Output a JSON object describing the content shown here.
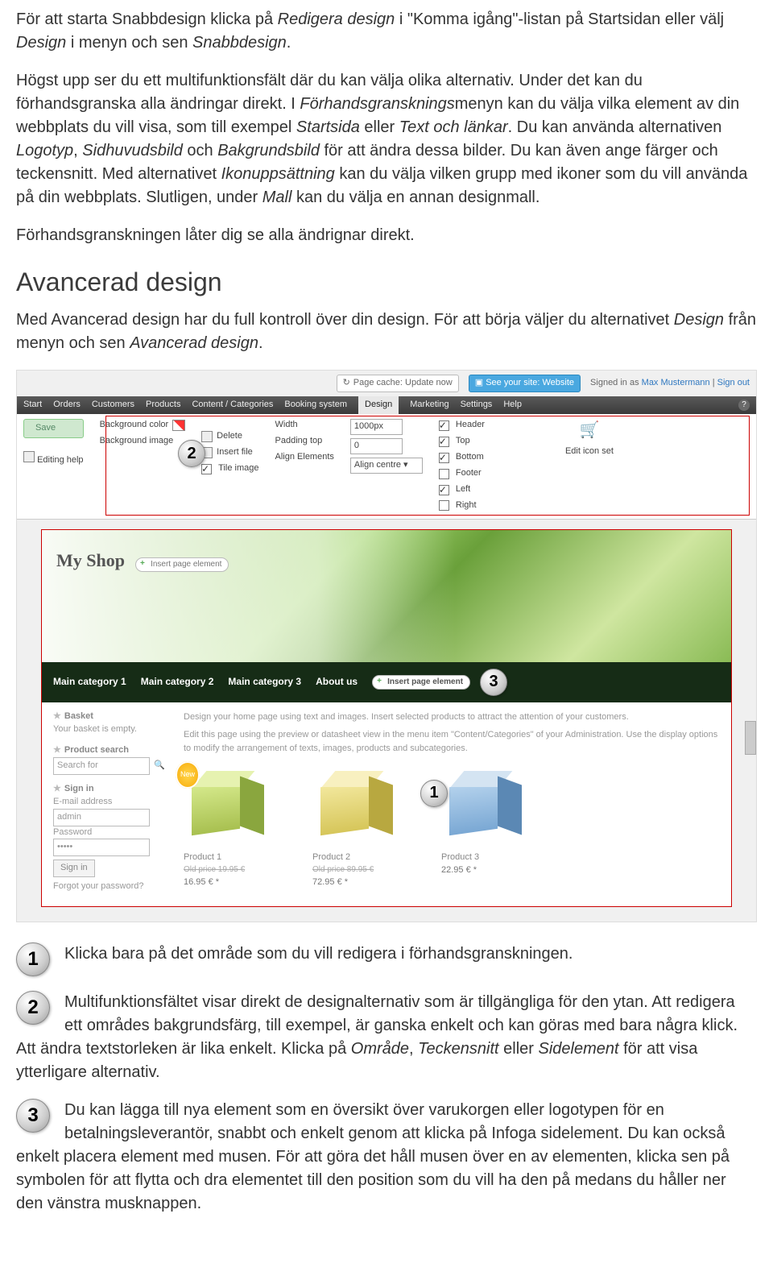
{
  "intro": {
    "p1_a": "För att starta Snabbdesign klicka på ",
    "p1_i1": "Redigera design",
    "p1_b": " i \"Komma igång\"-listan på Startsidan eller välj ",
    "p1_i2": "Design",
    "p1_c": " i menyn och sen ",
    "p1_i3": "Snabbdesign",
    "p1_d": ".",
    "p2_a": "Högst upp ser du ett multifunktionsfält där du kan välja olika alternativ. Under det kan du förhandsgranska alla ändringar direkt. I ",
    "p2_i1": "Förhandsgransknings",
    "p2_b": "menyn kan du välja vilka element av din webbplats du vill visa, som till exempel ",
    "p2_i2": "Startsida",
    "p2_c": " eller ",
    "p2_i3": "Text och länkar",
    "p2_d": ". Du kan använda alternativen ",
    "p2_i4": "Logotyp",
    "p2_e": ", ",
    "p2_i5": "Sidhuvudsbild",
    "p2_f": " och ",
    "p2_i6": "Bakgrundsbild",
    "p2_g": " för att ändra dessa bilder. Du kan även ange färger och teckensnitt. Med alternativet ",
    "p2_i7": "Ikonuppsättning",
    "p2_h": " kan du välja vilken grupp med ikoner som du vill använda på din webbplats. Slutligen, under ",
    "p2_i8": "Mall",
    "p2_j": " kan du välja en annan designmall.",
    "p3": "Förhandsgranskningen låter dig se alla ändrignar direkt."
  },
  "h2": "Avancerad design",
  "lead": {
    "a": "Med Avancerad design har du full kontroll över din design. För att börja väljer du alternativet ",
    "i1": "Design",
    "b": " från menyn och sen ",
    "i2": "Avancerad design",
    "c": "."
  },
  "ss": {
    "topbar": {
      "refresh_icon": "↻",
      "cache": "Page cache: Update now",
      "see_icon": "▣",
      "see": "See your site: Website",
      "signed": "Signed in as ",
      "user": "Max Mustermann",
      "sep": " | ",
      "signout": "Sign out"
    },
    "menu": [
      "Start",
      "Orders",
      "Customers",
      "Products",
      "Content / Categories",
      "Booking system",
      "Design",
      "Marketing",
      "Settings",
      "Help"
    ],
    "menu_active_index": 6,
    "toolbar": {
      "save": "Save",
      "editing_help": "Editing help",
      "bg_color": "Background color",
      "bg_image": "Background image",
      "delete": "Delete",
      "insert_file": "Insert file",
      "tile": "Tile image",
      "width": "Width",
      "width_val": "1000px",
      "padding": "Padding top",
      "padding_val": "0",
      "align": "Align Elements",
      "align_val": "Align centre",
      "header": "Header",
      "top": "Top",
      "bottom": "Bottom",
      "footer": "Footer",
      "left": "Left",
      "right": "Right",
      "edit_icon": "Edit icon set"
    },
    "shop": {
      "title": "My Shop",
      "insert": "Insert page element",
      "nav": [
        "Main category 1",
        "Main category 2",
        "Main category 3",
        "About us"
      ],
      "basket_hd": "Basket",
      "basket_empty": "Your basket is empty.",
      "search_hd": "Product search",
      "search_ph": "Search for",
      "signin_hd": "Sign in",
      "email_lbl": "E-mail address",
      "email_val": "admin",
      "pass_lbl": "Password",
      "pass_val": "•••••",
      "signin_btn": "Sign in",
      "forgot": "Forgot your password?",
      "desc1": "Design your home page using text and images. Insert selected products to attract the attention of your customers.",
      "desc2": "Edit this page using the preview or datasheet view in the menu item \"Content/Categories\" of your Administration. Use the display options to modify the arrangement of texts, images, products and subcategories.",
      "new": "New",
      "products": [
        {
          "name": "Product 1",
          "old": "Old price 19.95 €",
          "price": "16.95 € *"
        },
        {
          "name": "Product 2",
          "old": "Old price 89.95 €",
          "price": "72.95 € *"
        },
        {
          "name": "Product 3",
          "old": "",
          "price": "22.95 € *"
        }
      ]
    },
    "markers": {
      "m1": "1",
      "m2": "2",
      "m3": "3"
    }
  },
  "notes": {
    "n1": "Klicka bara på det område som du vill redigera i förhandsgranskningen.",
    "n2_a": "Multifunktionsfältet visar direkt de designalternativ som är tillgängliga för den ytan. Att redigera ett områdes bakgrundsfärg, till exempel, är ganska enkelt och kan göras med bara några klick. Att ändra textstorleken är lika enkelt. Klicka på ",
    "n2_i1": "Område",
    "n2_b": ", ",
    "n2_i2": "Teckensnitt",
    "n2_c": " eller ",
    "n2_i3": "Sidelement",
    "n2_d": " för att visa ytterligare alternativ.",
    "n3": "Du kan lägga till nya element som en översikt över varukorgen eller logotypen för en betalningsleverantör, snabbt och enkelt genom att klicka på Infoga sidelement. Du kan också enkelt placera element med musen. För att göra det håll musen över en av elementen, klicka sen på symbolen för att flytta och dra elementet till den position som du vill ha den på medans du håller ner den vänstra musknappen."
  }
}
